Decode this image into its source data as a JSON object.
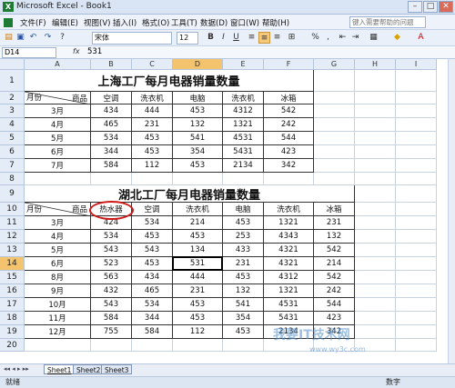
{
  "window": {
    "title": "Microsoft Excel - Book1",
    "app_icon": "excel-icon"
  },
  "menu": [
    "文件(F)",
    "编辑(E)",
    "视图(V)",
    "插入(I)",
    "格式(O)",
    "工具(T)",
    "数据(D)",
    "窗口(W)",
    "帮助(H)"
  ],
  "help_placeholder": "键入需要帮助的问题",
  "toolbar": {
    "font": "宋体",
    "size": "12",
    "bold": "B",
    "italic": "I",
    "underline": "U",
    "percent": "%",
    "comma": ","
  },
  "formula": {
    "name_box": "D14",
    "fx": "fx",
    "value": "531"
  },
  "columns": [
    "A",
    "B",
    "C",
    "D",
    "E",
    "F",
    "G",
    "H",
    "I"
  ],
  "rows": [
    "1",
    "2",
    "3",
    "4",
    "5",
    "6",
    "7",
    "8",
    "9",
    "10",
    "11",
    "12",
    "13",
    "14",
    "15",
    "16",
    "17",
    "18",
    "19",
    "20"
  ],
  "table1": {
    "title": "上海工厂每月电器销量数量",
    "corner_month": "月份",
    "corner_product": "商品",
    "headers": [
      "空调",
      "洗衣机",
      "电脑",
      "洗衣机",
      "冰箱"
    ],
    "rows": [
      [
        "3月",
        "434",
        "444",
        "453",
        "4312",
        "542"
      ],
      [
        "4月",
        "465",
        "231",
        "132",
        "1321",
        "242"
      ],
      [
        "5月",
        "534",
        "453",
        "541",
        "4531",
        "544"
      ],
      [
        "6月",
        "344",
        "453",
        "354",
        "5431",
        "423"
      ],
      [
        "7月",
        "584",
        "112",
        "453",
        "2134",
        "342"
      ]
    ]
  },
  "table2": {
    "title": "湖北工厂每月电器销量数量",
    "corner_month": "月份",
    "corner_product": "商品",
    "headers": [
      "热水器",
      "空调",
      "洗衣机",
      "电脑",
      "洗衣机",
      "冰箱"
    ],
    "rows": [
      [
        "3月",
        "424",
        "534",
        "214",
        "453",
        "1321",
        "231"
      ],
      [
        "4月",
        "534",
        "453",
        "453",
        "253",
        "4343",
        "132"
      ],
      [
        "5月",
        "543",
        "543",
        "134",
        "433",
        "4321",
        "542"
      ],
      [
        "6月",
        "523",
        "453",
        "531",
        "231",
        "4321",
        "214"
      ],
      [
        "8月",
        "563",
        "434",
        "444",
        "453",
        "4312",
        "542"
      ],
      [
        "9月",
        "432",
        "465",
        "231",
        "132",
        "1321",
        "242"
      ],
      [
        "10月",
        "543",
        "534",
        "453",
        "541",
        "4531",
        "544"
      ],
      [
        "11月",
        "584",
        "344",
        "453",
        "354",
        "5431",
        "423"
      ],
      [
        "12月",
        "755",
        "584",
        "112",
        "453",
        "2134",
        "342"
      ]
    ]
  },
  "sheets": [
    "Sheet1",
    "Sheet2",
    "Sheet3"
  ],
  "status": {
    "left": "就绪",
    "right": "数字"
  },
  "watermark": {
    "text": "我要IT技术网",
    "url": "www.wy3c.com"
  }
}
